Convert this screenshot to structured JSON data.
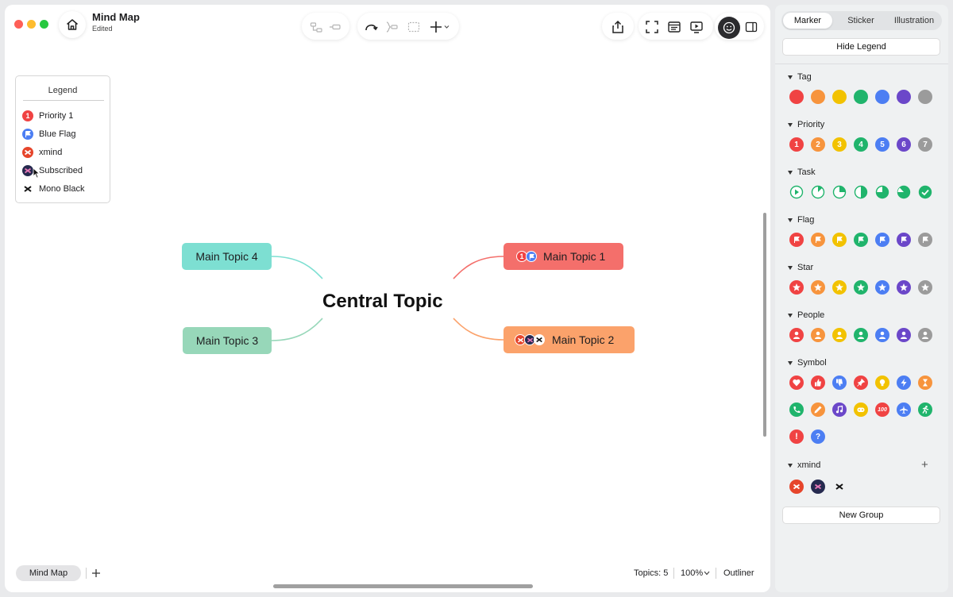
{
  "window": {
    "title": "Mind Map",
    "status": "Edited"
  },
  "legend": {
    "title": "Legend",
    "items": [
      {
        "label": "Priority 1",
        "icon": "priority-1-icon",
        "color": "#f04343"
      },
      {
        "label": "Blue Flag",
        "icon": "blue-flag-icon",
        "color": "#4c7ef3"
      },
      {
        "label": "xmind",
        "icon": "xmind-logo-icon",
        "color": "#e6452b"
      },
      {
        "label": "Subscribed",
        "icon": "subscribed-icon",
        "color": "#262a4f"
      },
      {
        "label": "Mono Black",
        "icon": "mono-black-icon",
        "color": "#111111"
      }
    ]
  },
  "map": {
    "central": "Central Topic",
    "topics": [
      {
        "id": "t1",
        "label": "Main Topic 1",
        "color": "#f46f6b"
      },
      {
        "id": "t2",
        "label": "Main Topic 2",
        "color": "#fba26b"
      },
      {
        "id": "t3",
        "label": "Main Topic 3",
        "color": "#97d7b9"
      },
      {
        "id": "t4",
        "label": "Main Topic 4",
        "color": "#7ddfd2"
      }
    ]
  },
  "footer": {
    "sheet": "Mind Map",
    "topics_count": "Topics: 5",
    "zoom": "100%",
    "outliner": "Outliner"
  },
  "panel": {
    "tabs": [
      "Marker",
      "Sticker",
      "Illustration"
    ],
    "active_tab": "Marker",
    "hide_legend": "Hide Legend",
    "new_group": "New Group",
    "groups": {
      "tag": "Tag",
      "priority": "Priority",
      "task": "Task",
      "flag": "Flag",
      "star": "Star",
      "people": "People",
      "symbol": "Symbol",
      "xmind": "xmind"
    },
    "priority_numbers": [
      "1",
      "2",
      "3",
      "4",
      "5",
      "6",
      "7"
    ],
    "palette": [
      "#f04343",
      "#f7943d",
      "#f2c200",
      "#20b46c",
      "#4c7ef3",
      "#6b47c9",
      "#9b9b9b"
    ],
    "symbol_badge": "100"
  }
}
